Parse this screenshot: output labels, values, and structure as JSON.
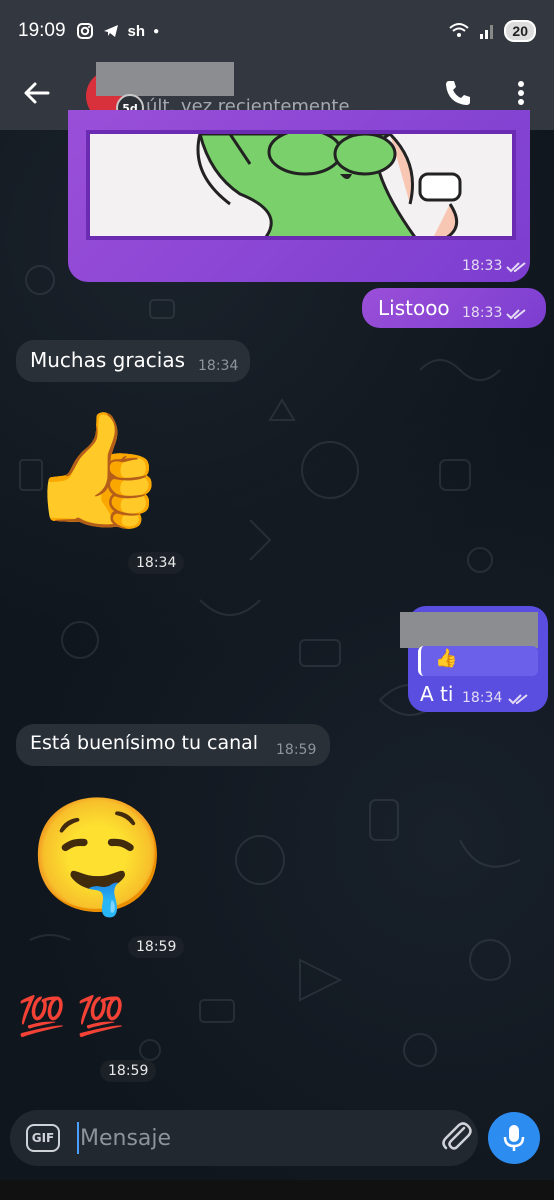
{
  "status_bar": {
    "time": "19:09",
    "left_icons": [
      "instagram-icon",
      "telegram-icon",
      "sh-icon",
      "dot"
    ],
    "sh_label": "sh",
    "battery": "20"
  },
  "header": {
    "last_seen": "últ. vez recientemente",
    "avatar_badge": "5d"
  },
  "messages": [
    {
      "type": "image-out",
      "time": "18:33"
    },
    {
      "type": "text-out",
      "text": "Listooo",
      "time": "18:33"
    },
    {
      "type": "text-in",
      "text": "Muchas gracias",
      "time": "18:34"
    },
    {
      "type": "emoji-in",
      "emoji": "👍",
      "time": "18:34"
    },
    {
      "type": "reply-out",
      "quoted_emoji": "👍",
      "text": "A ti",
      "time": "18:34"
    },
    {
      "type": "text-in",
      "text": "Está buenísimo tu canal",
      "time": "18:59"
    },
    {
      "type": "emoji-in",
      "emoji": "🤤",
      "time": "18:59"
    },
    {
      "type": "emoji-in",
      "emoji": "💯 💯",
      "time": "18:59"
    }
  ],
  "input": {
    "gif_label": "GIF",
    "placeholder": "Mensaje"
  },
  "colors": {
    "outgoing": "#8e46d6",
    "reply_bubble": "#5b4ee0",
    "incoming": "#2a3038",
    "accent": "#2d8cf0"
  }
}
